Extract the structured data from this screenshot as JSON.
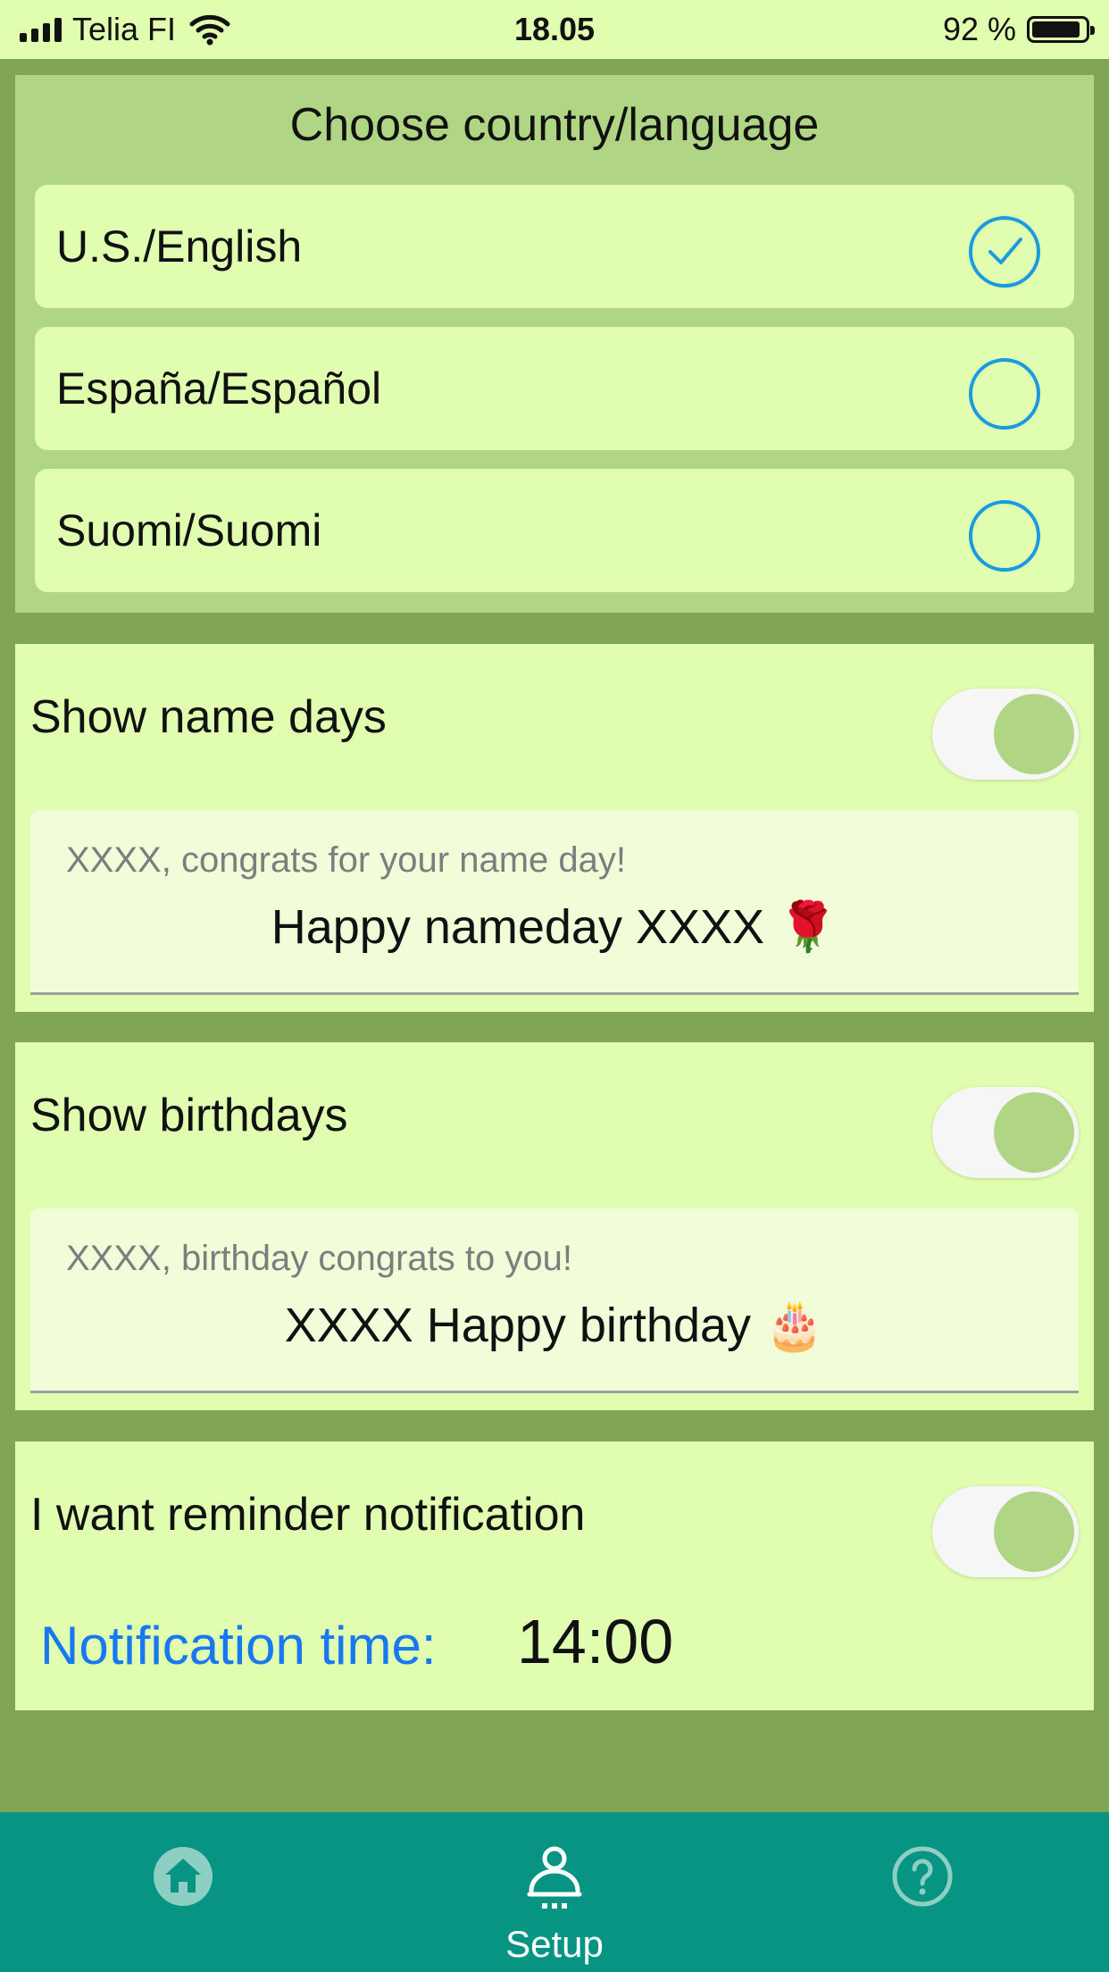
{
  "status_bar": {
    "carrier": "Telia FI",
    "time": "18.05",
    "battery": "92 %",
    "battery_level": 0.92
  },
  "language": {
    "title": "Choose country/language",
    "options": [
      {
        "label": "U.S./English",
        "selected": true
      },
      {
        "label": "España/Español",
        "selected": false
      },
      {
        "label": "Suomi/Suomi",
        "selected": false
      }
    ]
  },
  "name_days": {
    "label": "Show name days",
    "enabled": true,
    "placeholder": "XXXX, congrats for your name day!",
    "message": "Happy nameday XXXX 🌹"
  },
  "birthdays": {
    "label": "Show birthdays",
    "enabled": true,
    "placeholder": "XXXX, birthday congrats to you!",
    "message": "XXXX Happy birthday  🎂"
  },
  "reminder": {
    "label": "I want reminder notification",
    "enabled": true,
    "time_label": "Notification time:",
    "time_value": "14:00"
  },
  "tabbar": {
    "tabs": [
      {
        "icon": "home-icon",
        "label": ""
      },
      {
        "icon": "setup-icon",
        "label": "Setup"
      },
      {
        "icon": "help-icon",
        "label": ""
      }
    ],
    "active": "Setup"
  },
  "colors": {
    "accent_blue": "#1a9be0",
    "time_label_blue": "#1878f0",
    "tabbar": "#079483",
    "panel": "#e0fdb0",
    "background": "#80a655"
  }
}
